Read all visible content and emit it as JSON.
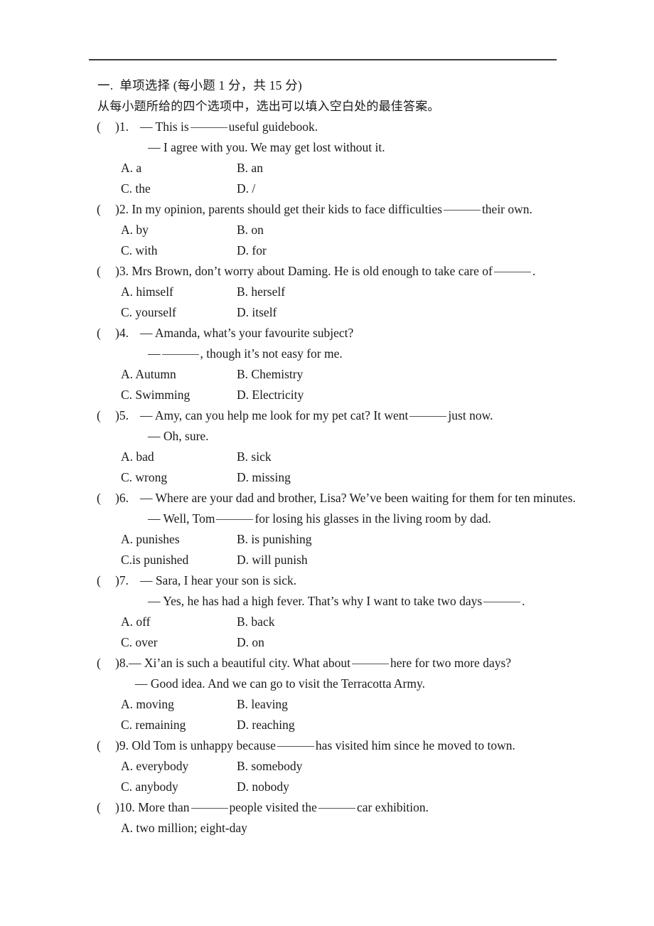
{
  "document": {
    "section_heading": "一.  单项选择 (每小题 1 分，共 15 分)",
    "instruction": "从每小题所给的四个选项中，选出可以填入空白处的最佳答案。",
    "paren_open": "(",
    "paren_close": ")"
  },
  "questions": [
    {
      "number": "1.",
      "style": "dialogue",
      "stem_before": "— This is",
      "stem_after": "useful guidebook.",
      "second_line": "— I agree with you. We may get lost without it.",
      "second_line_indent": "deep",
      "options": [
        "A. a",
        "B. an",
        "C. the",
        "D. /"
      ]
    },
    {
      "number": "2.",
      "style": "plain",
      "stem_before": "In my opinion, parents should get their kids to face difficulties",
      "stem_after": "their own.",
      "second_line": null,
      "options": [
        "A. by",
        "B. on",
        "C. with",
        "D. for"
      ]
    },
    {
      "number": "3.",
      "style": "plain",
      "stem_before": "Mrs Brown, don’t worry about Daming. He is old enough to take care of",
      "stem_after": ".",
      "second_line": null,
      "options": [
        "A. himself",
        "B. herself",
        "C. yourself",
        "D. itself"
      ]
    },
    {
      "number": "4.",
      "style": "dialogue",
      "stem_full": "— Amanda, what’s your favourite subject?",
      "second_line_before": "—",
      "second_line_after": ", though it’s not easy for me.",
      "second_line_indent": "deep",
      "options": [
        "A. Autumn",
        "B. Chemistry",
        "C. Swimming",
        "D. Electricity"
      ]
    },
    {
      "number": "5.",
      "style": "dialogue",
      "stem_before": "— Amy, can you help me look for my pet cat? It went",
      "stem_after": "just now.",
      "second_line": "— Oh, sure.",
      "second_line_indent": "deep",
      "options": [
        "A. bad",
        "B. sick",
        "C. wrong",
        "D. missing"
      ]
    },
    {
      "number": "6.",
      "style": "dialogue",
      "stem_full": "— Where are your dad and brother, Lisa? We’ve been waiting for them for ten minutes.",
      "second_line_before": "— Well, Tom",
      "second_line_after": "for losing his glasses in the living room by dad.",
      "second_line_indent": "deep",
      "options": [
        "A. punishes",
        "B. is punishing",
        "C.is punished",
        "D. will punish"
      ]
    },
    {
      "number": "7.",
      "style": "dialogue",
      "stem_full": "— Sara, I hear your son is sick.",
      "second_line_before": "— Yes, he has had a high fever. That’s why I want to take two days",
      "second_line_after": ".",
      "second_line_indent": "deep",
      "options": [
        "A. off",
        "B. back",
        "C. over",
        "D. on"
      ]
    },
    {
      "number": "8.",
      "style": "tight",
      "stem_before": "— Xi’an is such a beautiful city. What about",
      "stem_after": "here for two more days?",
      "second_line": "— Good idea. And we can go to visit the Terracotta Army.",
      "second_line_indent": "shallow",
      "options": [
        "A. moving",
        "B. leaving",
        "C. remaining",
        "D. reaching"
      ]
    },
    {
      "number": "9.",
      "style": "plain",
      "stem_before": "Old Tom is unhappy because",
      "stem_after": "has visited him since he moved to town.",
      "second_line": null,
      "options": [
        "A. everybody",
        "B. somebody",
        "C. anybody",
        "D. nobody"
      ]
    },
    {
      "number": "10.",
      "style": "plain-two-blanks",
      "stem_before": "More than",
      "stem_middle": "people visited the",
      "stem_after": "car exhibition.",
      "second_line": null,
      "options": [
        "A. two million; eight-day"
      ]
    }
  ]
}
